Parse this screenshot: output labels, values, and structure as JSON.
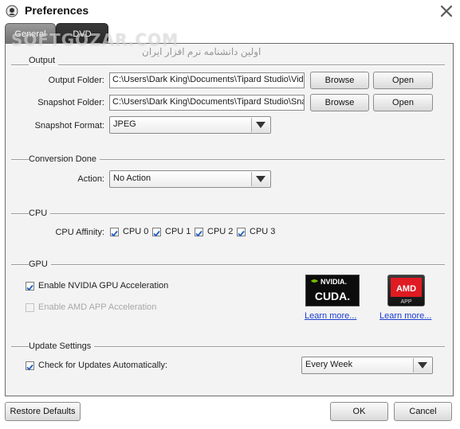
{
  "window": {
    "title": "Preferences"
  },
  "watermark": {
    "text": "SOFTGOZAR.COM",
    "subtext": "اولین دانشنامه نرم افزار ایران"
  },
  "tabs": [
    {
      "label": "General",
      "active": true
    },
    {
      "label": "DVD",
      "active": false
    }
  ],
  "output": {
    "section_label": "Output",
    "output_folder_label": "Output Folder:",
    "output_folder_value": "C:\\Users\\Dark King\\Documents\\Tipard Studio\\Video",
    "snapshot_folder_label": "Snapshot Folder:",
    "snapshot_folder_value": "C:\\Users\\Dark King\\Documents\\Tipard Studio\\Snapshot",
    "browse_label": "Browse",
    "open_label": "Open",
    "snapshot_format_label": "Snapshot Format:",
    "snapshot_format_value": "JPEG"
  },
  "conversion": {
    "section_label": "Conversion Done",
    "action_label": "Action:",
    "action_value": "No Action"
  },
  "cpu": {
    "section_label": "CPU",
    "affinity_label": "CPU Affinity:",
    "cores": [
      {
        "label": "CPU 0",
        "checked": true
      },
      {
        "label": "CPU 1",
        "checked": true
      },
      {
        "label": "CPU 2",
        "checked": true
      },
      {
        "label": "CPU 3",
        "checked": true
      }
    ]
  },
  "gpu": {
    "section_label": "GPU",
    "nvidia_label": "Enable NVIDIA GPU Acceleration",
    "nvidia_checked": true,
    "amd_label": "Enable AMD APP Acceleration",
    "amd_checked": false,
    "nvidia_logo_top": "NVIDIA.",
    "nvidia_logo_bottom": "CUDA.",
    "amd_logo_top": "AMD",
    "amd_logo_bottom": "APP",
    "learn_more_nvidia": "Learn more...",
    "learn_more_amd": "Learn more..."
  },
  "updates": {
    "section_label": "Update Settings",
    "check_label": "Check for Updates Automatically:",
    "check_checked": true,
    "frequency_value": "Every Week"
  },
  "footer": {
    "restore_label": "Restore Defaults",
    "ok_label": "OK",
    "cancel_label": "Cancel"
  },
  "colors": {
    "accent_check": "#1f5fbf",
    "link": "#1a3ccf",
    "nvidia_green": "#76b900",
    "amd_red": "#e01b22"
  },
  "icons": {
    "app": "app-logo-icon",
    "close": "close-icon",
    "dropdown": "chevron-down-icon",
    "check": "check-icon"
  }
}
